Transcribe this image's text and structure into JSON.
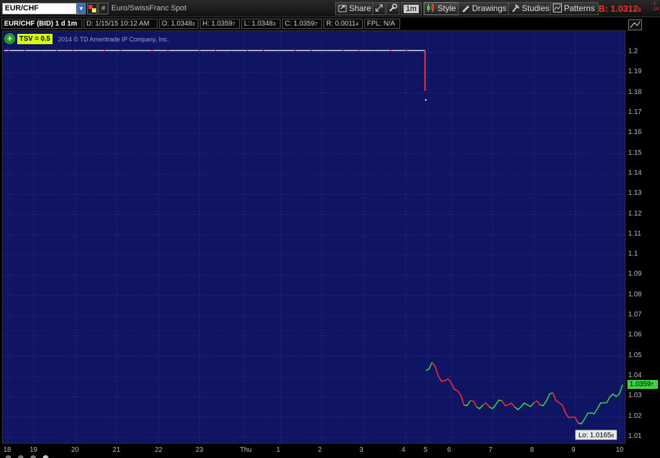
{
  "toolbar": {
    "symbol": "EUR/CHF",
    "hash": "#",
    "description": "Euro/SwissFranc Spot",
    "share": "Share",
    "interval": "1m",
    "style": "Style",
    "drawings": "Drawings",
    "studies": "Studies",
    "patterns": "Patterns",
    "bid": "B: 1.0312",
    "bid_sub": "6",
    "bid_change_1": "-1",
    "bid_change_2": "-14"
  },
  "info": {
    "symbol": "EUR/CHF (BID) 1 d 1m",
    "date": "D: 1/15/15 10:12 AM",
    "open": "O: 1.0348",
    "open_sub": "3",
    "high": "H: 1.0359",
    "high_sub": "7",
    "low": "L: 1.0348",
    "low_sub": "3",
    "close": "C: 1.0359",
    "close_sub": "7",
    "range": "R: 0.0011",
    "range_sub": "4",
    "fpl": "FPL: N/A"
  },
  "tsv": {
    "plus": "+",
    "label": "TSV  = 0.5"
  },
  "copyright": "2014 © TD Ameritrade IP Company, Inc.",
  "colors": {
    "plot_bg": "#0f1464",
    "up": "#3fd33f",
    "down": "#ff2a2a",
    "bid": "#ff2a2a"
  },
  "last_price": {
    "main": "1.0359",
    "sub": "7"
  },
  "low_label": {
    "main": "Lo: 1.0165",
    "sub": "8"
  },
  "chart_data": {
    "type": "line",
    "title": "",
    "y_ticks": [
      "1.2",
      "1.19",
      "1.18",
      "1.17",
      "1.16",
      "1.15",
      "1.14",
      "1.13",
      "1.12",
      "1.11",
      "1.1",
      "1.09",
      "1.08",
      "1.07",
      "1.06",
      "1.05",
      "1.04",
      "1.03",
      "1.02",
      "1.01"
    ],
    "x_ticks": [
      "18",
      "19",
      "20",
      "21",
      "22",
      "23",
      "Thu",
      "1",
      "2",
      "3",
      "4",
      "5",
      "6",
      "7",
      "8",
      "9",
      "10"
    ],
    "ylim": [
      1.005,
      1.205
    ],
    "grid": true,
    "series": [
      {
        "values_pre_break": 1.201,
        "drop_to": 1.181,
        "post_break": [
          1.043,
          1.047,
          1.04,
          1.038,
          1.037,
          1.033,
          1.026,
          1.028,
          1.025,
          1.026,
          1.025,
          1.026,
          1.028,
          1.026,
          1.025,
          1.025,
          1.026,
          1.027,
          1.026,
          1.028,
          1.032,
          1.027,
          1.022,
          1.02,
          1.017,
          1.019,
          1.022,
          1.024,
          1.027,
          1.03,
          1.03,
          1.036
        ]
      }
    ]
  }
}
